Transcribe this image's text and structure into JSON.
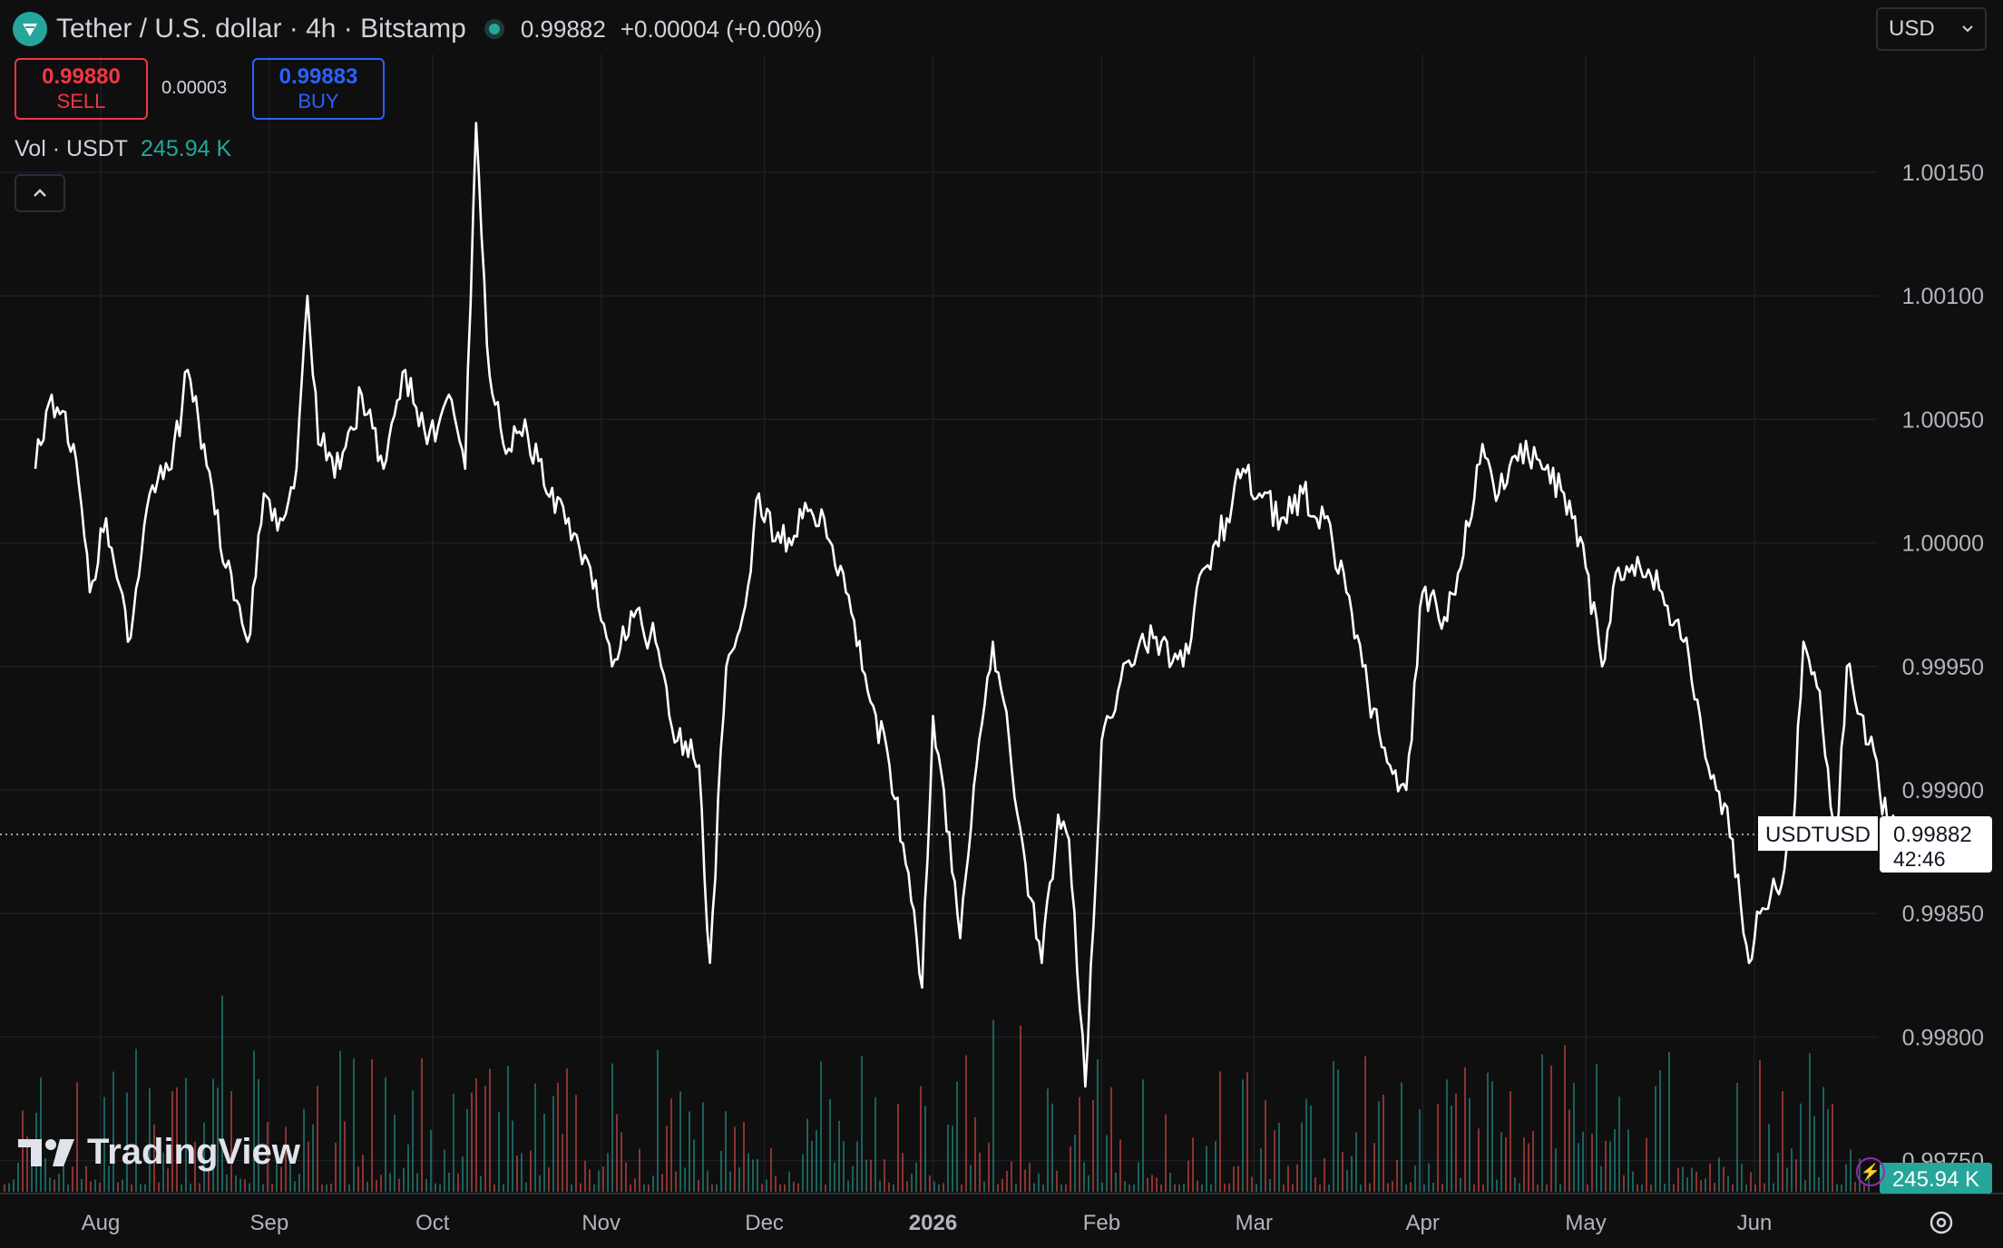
{
  "header": {
    "title": "Tether / U.S. dollar · 4h · Bitstamp",
    "last_price": "0.99882",
    "change": "+0.00004 (+0.00%)"
  },
  "currency": {
    "selected": "USD"
  },
  "trade": {
    "sell_price": "0.99880",
    "sell_label": "SELL",
    "spread": "0.00003",
    "buy_price": "0.99883",
    "buy_label": "BUY"
  },
  "volume_legend": {
    "label": "Vol · USDT",
    "value": "245.94 K"
  },
  "branding": {
    "watermark": "TradingView"
  },
  "colors": {
    "background": "#0f0f0f",
    "line": "#ffffff",
    "up": "#26a69a",
    "down": "#ef5350",
    "sell": "#f23645",
    "buy": "#2962ff"
  },
  "icons": [
    "tether-logo-icon",
    "status-dot-icon",
    "chevron-down-icon",
    "chevron-up-icon",
    "tradingview-logo-icon",
    "lightning-icon",
    "gear-icon"
  ],
  "chart_data": {
    "type": "line",
    "symbol": "USDTUSD",
    "interval": "4h",
    "x_labels": [
      "Aug",
      "Sep",
      "Oct",
      "Nov",
      "Dec",
      "2026",
      "Feb",
      "Mar",
      "Apr",
      "May",
      "Jun"
    ],
    "y_ticks": [
      "1.00150",
      "1.00100",
      "1.00050",
      "1.00000",
      "0.99950",
      "0.99900",
      "0.99850",
      "0.99800",
      "0.99750"
    ],
    "ylim": [
      0.9975,
      1.0015
    ],
    "grid": true,
    "current_price": "0.99882",
    "countdown": "42:46",
    "current_volume": "245.94 K",
    "series": [
      {
        "points": [
          [
            "Jul 20",
            1.0003
          ],
          [
            "Jul 23",
            1.0006
          ],
          [
            "Jul 27",
            1.0004
          ],
          [
            "Jul 30",
            0.9998
          ],
          [
            "Aug 2",
            1.0001
          ],
          [
            "Aug 6",
            0.9996
          ],
          [
            "Aug 10",
            1.0002
          ],
          [
            "Aug 14",
            1.0003
          ],
          [
            "Aug 17",
            1.0007
          ],
          [
            "Aug 20",
            1.0004
          ],
          [
            "Aug 24",
            0.9999
          ],
          [
            "Aug 28",
            0.9996
          ],
          [
            "Aug 31",
            1.0002
          ],
          [
            "Sep 3",
            1.0001
          ],
          [
            "Sep 6",
            1.0003
          ],
          [
            "Sep 8",
            1.001
          ],
          [
            "Sep 10",
            1.0004
          ],
          [
            "Sep 14",
            1.0003
          ],
          [
            "Sep 18",
            1.0006
          ],
          [
            "Sep 22",
            1.0003
          ],
          [
            "Sep 26",
            1.0007
          ],
          [
            "Sep 30",
            1.0004
          ],
          [
            "Oct 4",
            1.0006
          ],
          [
            "Oct 7",
            1.0003
          ],
          [
            "Oct 9",
            1.0017
          ],
          [
            "Oct 11",
            1.0008
          ],
          [
            "Oct 14",
            1.0004
          ],
          [
            "Oct 18",
            1.0005
          ],
          [
            "Oct 22",
            1.0002
          ],
          [
            "Oct 26",
            1.0001
          ],
          [
            "Oct 30",
            0.9999
          ],
          [
            "Nov 3",
            0.9995
          ],
          [
            "Nov 7",
            0.9997
          ],
          [
            "Nov 11",
            0.9996
          ],
          [
            "Nov 15",
            0.9992
          ],
          [
            "Nov 19",
            0.9991
          ],
          [
            "Nov 21",
            0.9983
          ],
          [
            "Nov 24",
            0.9995
          ],
          [
            "Nov 27",
            0.9997
          ],
          [
            "Nov 30",
            1.0002
          ],
          [
            "Dec 4",
            1.0
          ],
          [
            "Dec 8",
            1.0001
          ],
          [
            "Dec 12",
            1.0001
          ],
          [
            "Dec 16",
            0.9998
          ],
          [
            "Dec 20",
            0.9994
          ],
          [
            "Dec 24",
            0.9991
          ],
          [
            "Dec 27",
            0.9987
          ],
          [
            "Dec 30",
            0.9982
          ],
          [
            "Jan 1",
            0.9993
          ],
          [
            "Jan 3",
            0.999
          ],
          [
            "Jan 6",
            0.9984
          ],
          [
            "Jan 9",
            0.9991
          ],
          [
            "Jan 12",
            0.9996
          ],
          [
            "Jan 15",
            0.9992
          ],
          [
            "Jan 18",
            0.9987
          ],
          [
            "Jan 21",
            0.9983
          ],
          [
            "Jan 24",
            0.9989
          ],
          [
            "Jan 26",
            0.9988
          ],
          [
            "Jan 29",
            0.9978
          ],
          [
            "Feb 1",
            0.9992
          ],
          [
            "Feb 4",
            0.9994
          ],
          [
            "Feb 8",
            0.9996
          ],
          [
            "Feb 12",
            0.9996
          ],
          [
            "Feb 16",
            0.9995
          ],
          [
            "Feb 20",
            0.9999
          ],
          [
            "Feb 24",
            1.0001
          ],
          [
            "Feb 27",
            1.0003
          ],
          [
            "Mar 2",
            1.0002
          ],
          [
            "Mar 6",
            1.0001
          ],
          [
            "Mar 10",
            1.0002
          ],
          [
            "Mar 14",
            1.0001
          ],
          [
            "Mar 18",
            0.9998
          ],
          [
            "Mar 22",
            0.9994
          ],
          [
            "Mar 26",
            0.9991
          ],
          [
            "Mar 29",
            0.999
          ],
          [
            "Apr 1",
            0.9998
          ],
          [
            "Apr 5",
            0.9997
          ],
          [
            "Apr 8",
            0.9999
          ],
          [
            "Apr 12",
            1.0004
          ],
          [
            "Apr 15",
            1.0002
          ],
          [
            "Apr 19",
            1.0004
          ],
          [
            "Apr 23",
            1.0003
          ],
          [
            "Apr 27",
            1.0002
          ],
          [
            "May 1",
            0.9999
          ],
          [
            "May 4",
            0.9995
          ],
          [
            "May 7",
            0.9999
          ],
          [
            "May 11",
            0.9999
          ],
          [
            "May 15",
            0.9998
          ],
          [
            "May 19",
            0.9996
          ],
          [
            "May 22",
            0.9993
          ],
          [
            "May 25",
            0.999
          ],
          [
            "May 28",
            0.9988
          ],
          [
            "May 31",
            0.9983
          ],
          [
            "Jun 2",
            0.9985
          ],
          [
            "Jun 5",
            0.9986
          ],
          [
            "Jun 8",
            0.9988
          ],
          [
            "Jun 10",
            0.9996
          ],
          [
            "Jun 13",
            0.9994
          ],
          [
            "Jun 16",
            0.9988
          ],
          [
            "Jun 18",
            0.9995
          ],
          [
            "Jun 21",
            0.9993
          ],
          [
            "Jun 24",
            0.999
          ],
          [
            "Jun 27",
            0.9988
          ],
          [
            "Jun 30",
            0.99882
          ]
        ]
      }
    ]
  }
}
